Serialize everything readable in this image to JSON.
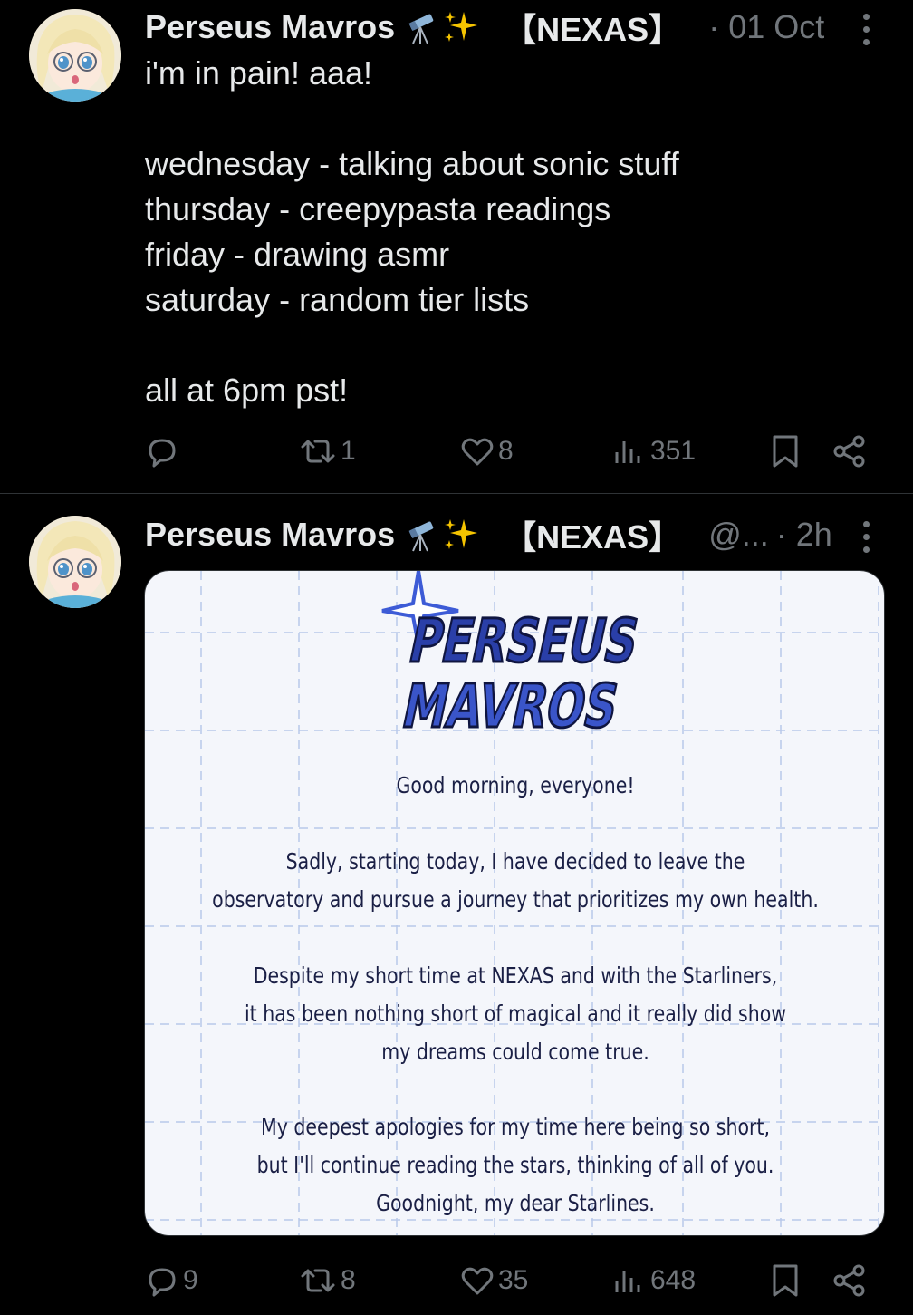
{
  "tweets": [
    {
      "author": {
        "name": "Perseus Mavros",
        "emojis": [
          "telescope-emoji",
          "sparkles-emoji"
        ],
        "org": "【NEXAS】",
        "handle": "",
        "time": "· 01 Oct"
      },
      "text": "i'm in pain! aaa!\n\nwednesday - talking about sonic stuff\nthursday - creepypasta readings\nfriday - drawing asmr\nsaturday - random tier lists\n\nall at 6pm pst!",
      "stats": {
        "replies": "",
        "reposts": "1",
        "likes": "8",
        "views": "351"
      }
    },
    {
      "author": {
        "name": "Perseus Mavros",
        "emojis": [
          "telescope-emoji",
          "sparkles-emoji"
        ],
        "org": "【NEXAS】",
        "handle": "@...",
        "time": "· 2h"
      },
      "media": {
        "logo_line1": "PERSEUS",
        "logo_line2": "MAVROS",
        "greeting": "Good morning, everyone!",
        "paragraph1": "Sadly, starting today, I have decided to leave the\nobservatory and pursue a journey that prioritizes my own health.",
        "paragraph2": "Despite my short time at NEXAS and with the Starliners,\nit has been nothing short of magical and it really did show\nmy dreams could come true.",
        "paragraph3": "My deepest apologies for my time here being so short,\nbut I'll continue reading the stars, thinking of all of you.\nGoodnight, my dear Starlines."
      },
      "stats": {
        "replies": "9",
        "reposts": "8",
        "likes": "35",
        "views": "648"
      }
    }
  ],
  "colors": {
    "background": "#000000",
    "text": "#e7e9ea",
    "muted": "#71767b",
    "divider": "#2f3336",
    "card_text": "#1a1f45",
    "logo_blue": "#3d5bd6"
  }
}
